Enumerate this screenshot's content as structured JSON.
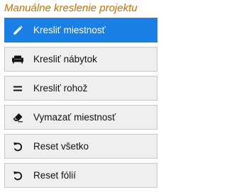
{
  "panel": {
    "title": "Manuálne kreslenie projektu",
    "title_color": "#c8700a"
  },
  "buttons": [
    {
      "label": "Kresliť miestnosť",
      "icon": "pencil-icon",
      "active": true
    },
    {
      "label": "Kresliť nábytok",
      "icon": "sofa-icon",
      "active": false
    },
    {
      "label": "Kresliť rohož",
      "icon": "equals-icon",
      "active": false
    },
    {
      "label": "Vymazať miestnosť",
      "icon": "eraser-icon",
      "active": false
    },
    {
      "label": "Reset všetko",
      "icon": "undo-icon",
      "active": false
    },
    {
      "label": "Reset fólií",
      "icon": "undo-icon",
      "active": false
    }
  ],
  "colors": {
    "active_bg": "#1a80e6",
    "button_bg": "#efefef",
    "button_border": "#c9c9c9"
  }
}
